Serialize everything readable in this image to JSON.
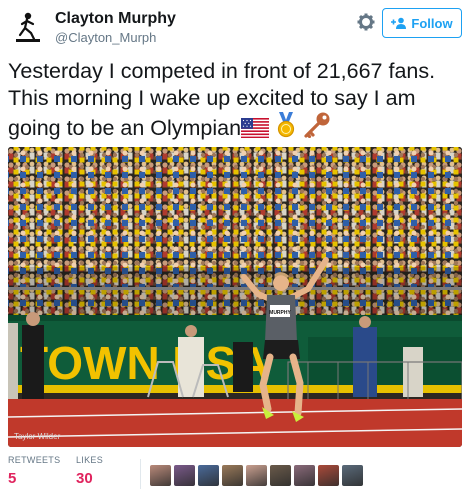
{
  "author": {
    "display_name": "Clayton Murphy",
    "handle": "@Clayton_Murph"
  },
  "actions": {
    "follow_label": "Follow"
  },
  "tweet": {
    "text": "Yesterday I competed in front of 21,667 fans. This morning I wake up excited to say I am going to be an Olympian",
    "emojis": [
      "us-flag-icon",
      "medal-icon",
      "key-icon"
    ]
  },
  "photo": {
    "banner_text": "TOWN USA",
    "bib_name": "MURPHY",
    "credit": "Taylor Wilder"
  },
  "stats": {
    "retweets_label": "RETWEETS",
    "retweets_count": "5",
    "likes_label": "LIKES",
    "likes_count": "30"
  },
  "likers": {
    "colors": [
      "#b98a7a",
      "#7a5a8a",
      "#4a6a9a",
      "#9a7a5a",
      "#c9a090",
      "#6a5a4a",
      "#8a6a7a",
      "#aa4a3a",
      "#5a6a7a"
    ]
  },
  "colors": {
    "accent": "#1da1f2",
    "likes": "#e0245e",
    "track": "#c0392b"
  }
}
